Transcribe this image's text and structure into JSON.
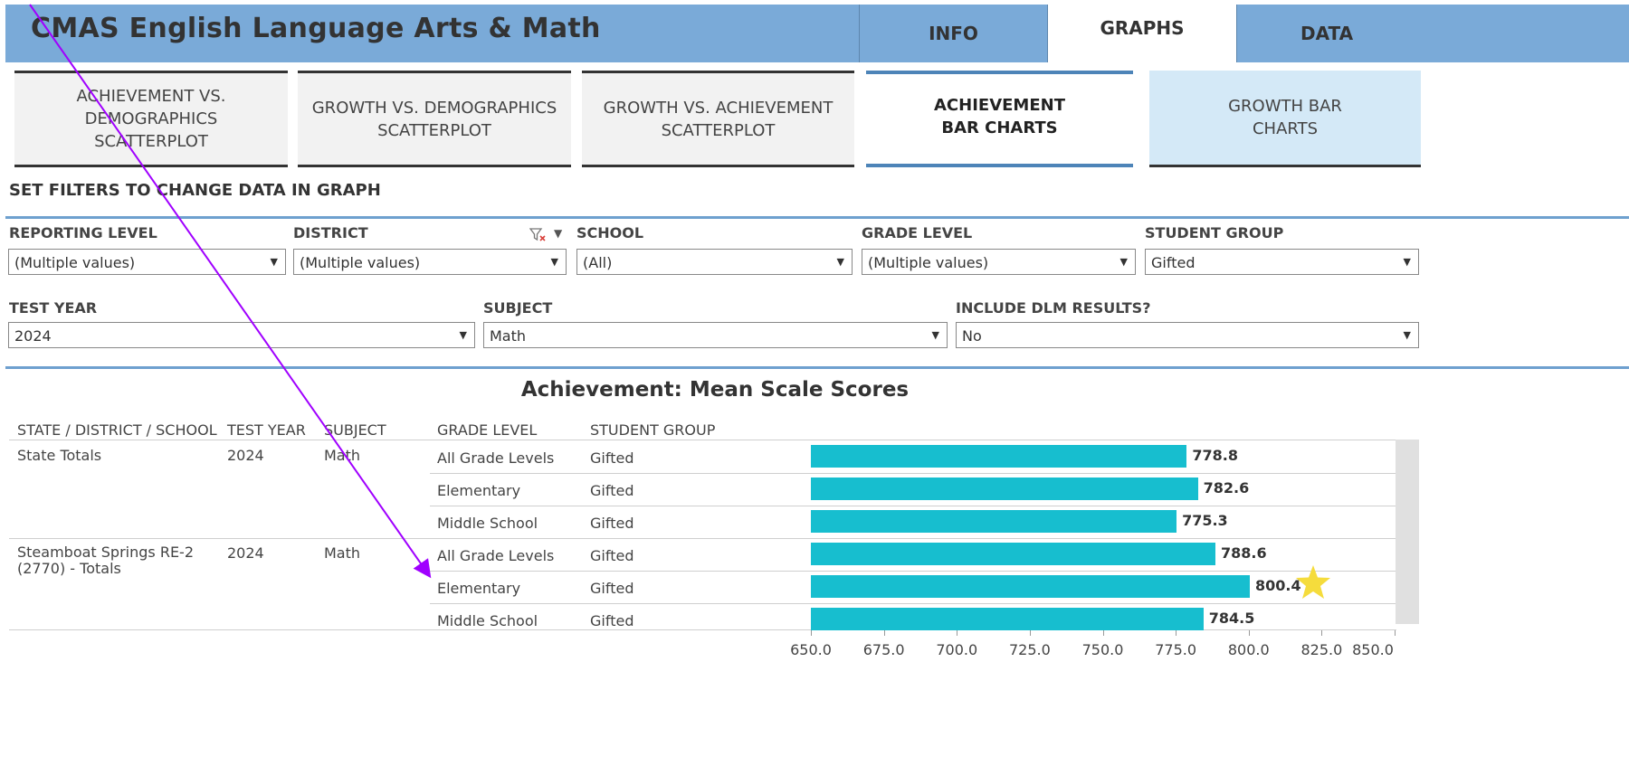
{
  "header": {
    "title": "CMAS English Language Arts & Math",
    "tabs": [
      "INFO",
      "GRAPHS",
      "DATA"
    ]
  },
  "subtabs": [
    "ACHIEVEMENT VS. DEMOGRAPHICS SCATTERPLOT",
    "GROWTH VS. DEMOGRAPHICS SCATTERPLOT",
    "GROWTH VS. ACHIEVEMENT SCATTERPLOT",
    "ACHIEVEMENT BAR CHARTS",
    "GROWTH BAR CHARTS"
  ],
  "filters_hint": "SET FILTERS TO CHANGE DATA IN GRAPH",
  "filters": {
    "reporting_level": {
      "label": "REPORTING LEVEL",
      "value": "(Multiple values)"
    },
    "district": {
      "label": "DISTRICT",
      "value": "(Multiple values)"
    },
    "school": {
      "label": "SCHOOL",
      "value": "(All)"
    },
    "grade_level": {
      "label": "GRADE LEVEL",
      "value": "(Multiple values)"
    },
    "student_group": {
      "label": "STUDENT GROUP",
      "value": "Gifted"
    },
    "test_year": {
      "label": "TEST YEAR",
      "value": "2024"
    },
    "subject": {
      "label": "SUBJECT",
      "value": "Math"
    },
    "include_dlm": {
      "label": "INCLUDE DLM RESULTS?",
      "value": "No"
    }
  },
  "table": {
    "headers": [
      "STATE / DISTRICT / SCHOOL",
      "TEST YEAR",
      "SUBJECT",
      "GRADE LEVEL",
      "STUDENT GROUP"
    ],
    "groups": [
      {
        "name": "State Totals",
        "year": "2024",
        "subject": "Math"
      },
      {
        "name": "Steamboat Springs RE-2 (2770) - Totals",
        "year": "2024",
        "subject": "Math"
      }
    ],
    "rows": [
      {
        "grade": "All Grade Levels",
        "group": "Gifted"
      },
      {
        "grade": "Elementary",
        "group": "Gifted"
      },
      {
        "grade": "Middle School",
        "group": "Gifted"
      },
      {
        "grade": "All Grade Levels",
        "group": "Gifted"
      },
      {
        "grade": "Elementary",
        "group": "Gifted"
      },
      {
        "grade": "Middle School",
        "group": "Gifted"
      }
    ]
  },
  "chart_data": {
    "type": "bar",
    "title": "Achievement: Mean Scale Scores",
    "orientation": "horizontal",
    "categories": [
      "State Totals - All Grade Levels",
      "State Totals - Elementary",
      "State Totals - Middle School",
      "Steamboat Springs RE-2 - All Grade Levels",
      "Steamboat Springs RE-2 - Elementary",
      "Steamboat Springs RE-2 - Middle School"
    ],
    "values": [
      778.8,
      782.6,
      775.3,
      788.6,
      800.4,
      784.5
    ],
    "value_labels": [
      "778.8",
      "782.6",
      "775.3",
      "788.6",
      "800.4",
      "784.5"
    ],
    "xlim": [
      650,
      850
    ],
    "xticks": [
      "650.0",
      "675.0",
      "700.0",
      "725.0",
      "750.0",
      "775.0",
      "800.0",
      "825.0",
      "850.0"
    ],
    "bar_color": "#17becf",
    "highlight_color": "#f5dc3c"
  },
  "colors": {
    "header_bg": "#7aaad8",
    "active_subtab_border": "#4d84b8",
    "growth_tab_bg": "#d4e9f7",
    "arrow": "#a000ff"
  },
  "icons": [
    "filter-clear-icon",
    "dropdown-caret-icon",
    "star-icon"
  ]
}
